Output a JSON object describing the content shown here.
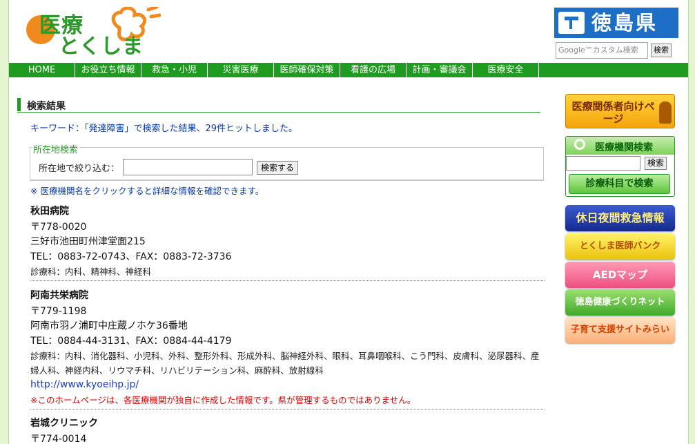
{
  "header": {
    "logo_line1": "医療",
    "logo_line2": "とくしま",
    "pref_name": "徳島県",
    "search_placeholder": "Google™カスタム検索",
    "search_button": "検索"
  },
  "nav": {
    "items": [
      "HOME",
      "お役立ち情報",
      "救急・小児",
      "災害医療",
      "医師確保対策",
      "看護の広場",
      "計画・審議会",
      "医療安全"
    ]
  },
  "main": {
    "title": "検索結果",
    "keyword_line": "キーワード：「発達障害」で検索した結果、29件ヒットしました。",
    "location_search": {
      "legend": "所在地検索",
      "label": "所在地で絞り込む：",
      "input_value": "",
      "button": "検索する"
    },
    "note": "※ 医療機関名をクリックすると詳細な情報を確認できます。",
    "hospitals": [
      {
        "name": "秋田病院",
        "postal": "〒778-0020",
        "address": "三好市池田町州津堂面215",
        "tel_fax": "TEL：0883-72-0743、FAX：0883-72-3736",
        "departments": "診療科：内科、精神科、神経科"
      },
      {
        "name": "阿南共栄病院",
        "postal": "〒779-1198",
        "address": "阿南市羽ノ浦町中庄蔵ノホケ36番地",
        "tel_fax": "TEL：0884-44-3131、FAX：0884-44-4179",
        "departments": "診療科：内科、消化器科、小児科、外科、整形外科、形成外科、脳神経外科、眼科、耳鼻咽喉科、こう門科、皮膚科、泌尿器科、産婦人科、神経内科、リウマチ科、リハビリテーション科、麻酔科、放射線科",
        "url": "http://www.kyoeihp.jp/",
        "warning": "※このホームページは、各医療機関が独自に作成した情報です。県が管理するものではありません。"
      },
      {
        "name": "岩城クリニック",
        "postal": "〒774-0014"
      }
    ]
  },
  "sidebar": {
    "staff_button": "医療関係者向けページ",
    "search_box_title": "医療機関検索",
    "search_box_button": "検索",
    "dept_search_button": "診療科目で検索",
    "banners": [
      "休日夜間救急情報",
      "とくしま医師バンク",
      "AEDマップ",
      "徳島健康づくりネット",
      "子育て支援サイトみらい"
    ]
  }
}
